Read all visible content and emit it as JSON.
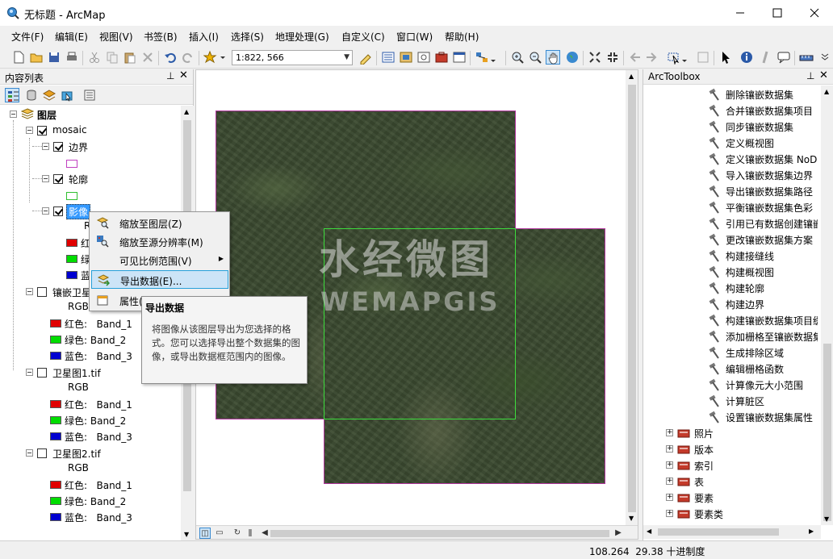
{
  "window": {
    "title": "无标题 - ArcMap",
    "controls": [
      "minimize",
      "maximize",
      "close"
    ]
  },
  "menu": [
    "文件(F)",
    "编辑(E)",
    "视图(V)",
    "书签(B)",
    "插入(I)",
    "选择(S)",
    "地理处理(G)",
    "自定义(C)",
    "窗口(W)",
    "帮助(H)"
  ],
  "toolbar": {
    "scale": "1:822, 566"
  },
  "toc": {
    "title": "内容列表",
    "root": "图层",
    "group": "mosaic",
    "sublayers": {
      "boundary": "边界",
      "outline": "轮廓",
      "image": "影像"
    },
    "image_rgb_partial": "R",
    "image_bands_partial": [
      "红",
      "绿",
      "蓝"
    ],
    "layers": [
      {
        "name": "镶嵌卫星",
        "rgb": "RGB",
        "bands": [
          "红色:   Band_1",
          "绿色: Band_2",
          "蓝色:   Band_3"
        ]
      },
      {
        "name": "卫星图1.tif",
        "rgb": "RGB",
        "bands": [
          "红色:   Band_1",
          "绿色: Band_2",
          "蓝色:   Band_3"
        ]
      },
      {
        "name": "卫星图2.tif",
        "rgb": "RGB",
        "bands": [
          "红色:   Band_1",
          "绿色: Band_2",
          "蓝色:   Band_3"
        ]
      }
    ],
    "band_colors": [
      "#e00000",
      "#00dd00",
      "#0000d0"
    ]
  },
  "context_menu": {
    "items": [
      {
        "label": "缩放至图层(Z)",
        "icon": "zoom-to-layer-icon"
      },
      {
        "label": "缩放至源分辨率(M)",
        "icon": "zoom-resolution-icon"
      },
      {
        "label": "可见比例范围(V)",
        "icon": "",
        "submenu": true
      },
      {
        "label": "导出数据(E)...",
        "icon": "export-data-icon",
        "highlighted": true
      },
      {
        "label": "属性(",
        "icon": "properties-icon"
      }
    ]
  },
  "tooltip": {
    "title": "导出数据",
    "body": "将图像从该图层导出为您选择的格式。您可以选择导出整个数据集的图像，或导出数据框范围内的图像。"
  },
  "map": {
    "watermark_cn": "水经微图",
    "watermark_en": "WEMAPGIS"
  },
  "arctoolbox": {
    "title": "ArcToolbox",
    "tools": [
      "删除镶嵌数据集",
      "合并镶嵌数据集项目",
      "同步镶嵌数据集",
      "定义概视图",
      "定义镶嵌数据集 NoD",
      "导入镶嵌数据集边界",
      "导出镶嵌数据集路径",
      "平衡镶嵌数据集色彩",
      "引用已有数据创建镶嵌",
      "更改镶嵌数据集方案",
      "构建接缝线",
      "构建概视图",
      "构建轮廓",
      "构建边界",
      "构建镶嵌数据集项目缓",
      "添加栅格至镶嵌数据集",
      "生成排除区域",
      "编辑栅格函数",
      "计算像元大小范围",
      "计算脏区",
      "设置镶嵌数据集属性"
    ],
    "toolsets": [
      "照片",
      "版本",
      "索引",
      "表",
      "要素",
      "要素类"
    ]
  },
  "status": {
    "coords": "108.264  29.38 十进制度"
  }
}
